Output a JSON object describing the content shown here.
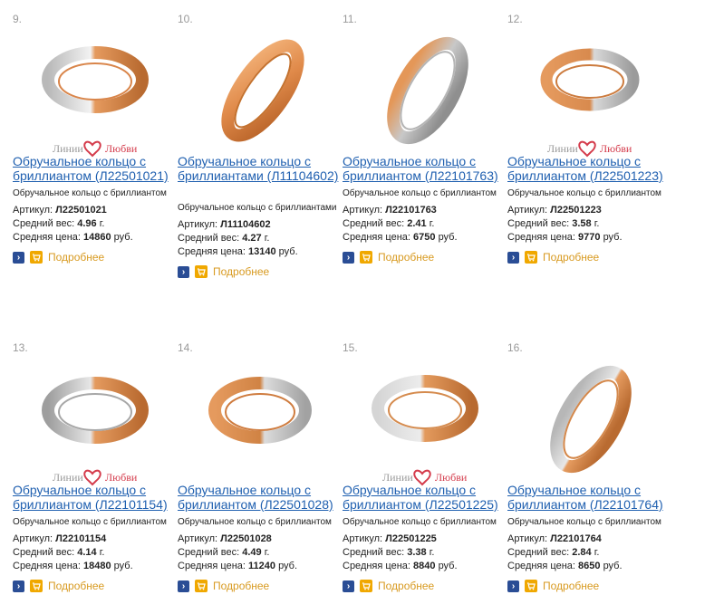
{
  "common": {
    "more_label": "Подробнее",
    "article_label": "Артикул:",
    "weight_label": "Средний вес:",
    "price_label": "Средняя цена:",
    "weight_unit": "г.",
    "price_unit": "руб.",
    "brand_left": "Линии",
    "brand_right": "Любви",
    "go_icon": "arrow-right-icon",
    "cart_icon": "cart-icon",
    "accent_blue": "#2060b0",
    "accent_orange": "#f0a800"
  },
  "products": [
    {
      "num": "9.",
      "title": "Обручальное кольцо с бриллиантом (Л22501021)",
      "desc": "Обручальное кольцо с бриллиантом",
      "article": "Л22501021",
      "weight": "4.96",
      "price": "14860",
      "brand": true
    },
    {
      "num": "10.",
      "title": "Обручальное кольцо с бриллиантами (Л11104602)",
      "desc": "Обручальное кольцо с бриллиантами",
      "article": "Л11104602",
      "weight": "4.27",
      "price": "13140",
      "brand": false
    },
    {
      "num": "11.",
      "title": "Обручальное кольцо с бриллиантом (Л22101763)",
      "desc": "Обручальное кольцо с бриллиантом",
      "article": "Л22101763",
      "weight": "2.41",
      "price": "6750",
      "brand": false
    },
    {
      "num": "12.",
      "title": "Обручальное кольцо с бриллиантом (Л22501223)",
      "desc": "Обручальное кольцо с бриллиантом",
      "article": "Л22501223",
      "weight": "3.58",
      "price": "9770",
      "brand": true
    },
    {
      "num": "13.",
      "title": "Обручальное кольцо с бриллиантом (Л22101154)",
      "desc": "Обручальное кольцо с бриллиантом",
      "article": "Л22101154",
      "weight": "4.14",
      "price": "18480",
      "brand": true
    },
    {
      "num": "14.",
      "title": "Обручальное кольцо с бриллиантом (Л22501028)",
      "desc": "Обручальное кольцо с бриллиантом",
      "article": "Л22501028",
      "weight": "4.49",
      "price": "11240",
      "brand": false
    },
    {
      "num": "15.",
      "title": "Обручальное кольцо с бриллиантом (Л22501225)",
      "desc": "Обручальное кольцо с бриллиантом",
      "article": "Л22501225",
      "weight": "3.38",
      "price": "8840",
      "brand": true
    },
    {
      "num": "16.",
      "title": "Обручальное кольцо с бриллиантом (Л22101764)",
      "desc": "Обручальное кольцо с бриллиантом",
      "article": "Л22101764",
      "weight": "2.84",
      "price": "8650",
      "brand": false
    }
  ]
}
